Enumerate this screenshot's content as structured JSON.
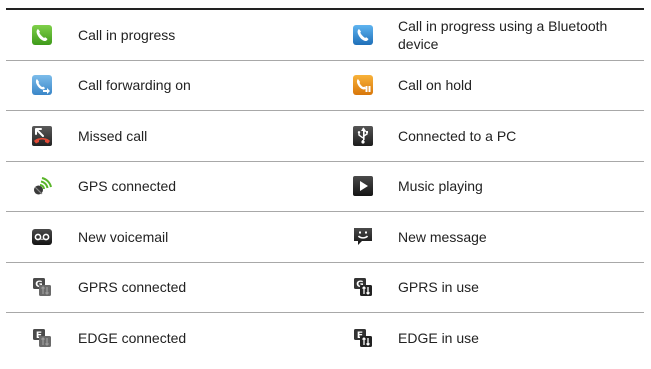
{
  "rows": [
    {
      "left": {
        "icon": "phone-green-icon",
        "label": "Call in progress"
      },
      "right": {
        "icon": "phone-bluetooth-icon",
        "label": "Call in progress using a Bluetooth device"
      }
    },
    {
      "left": {
        "icon": "call-forward-icon",
        "label": "Call forwarding on"
      },
      "right": {
        "icon": "call-hold-icon",
        "label": "Call on hold"
      }
    },
    {
      "left": {
        "icon": "missed-call-icon",
        "label": "Missed call"
      },
      "right": {
        "icon": "usb-icon",
        "label": "Connected to a PC"
      }
    },
    {
      "left": {
        "icon": "gps-icon",
        "label": "GPS connected"
      },
      "right": {
        "icon": "play-icon",
        "label": "Music playing"
      }
    },
    {
      "left": {
        "icon": "voicemail-icon",
        "label": "New voicemail"
      },
      "right": {
        "icon": "message-icon",
        "label": "New message"
      }
    },
    {
      "left": {
        "icon": "gprs-connected-icon",
        "label": "GPRS connected"
      },
      "right": {
        "icon": "gprs-in-use-icon",
        "label": "GPRS in use"
      }
    },
    {
      "left": {
        "icon": "edge-connected-icon",
        "label": "EDGE connected"
      },
      "right": {
        "icon": "edge-in-use-icon",
        "label": "EDGE in use"
      }
    }
  ],
  "colors": {
    "green": "#5ab52a",
    "blue": "#2f8fd8",
    "orange": "#f0900a",
    "red": "#d23a2a",
    "dark": "#333333"
  }
}
